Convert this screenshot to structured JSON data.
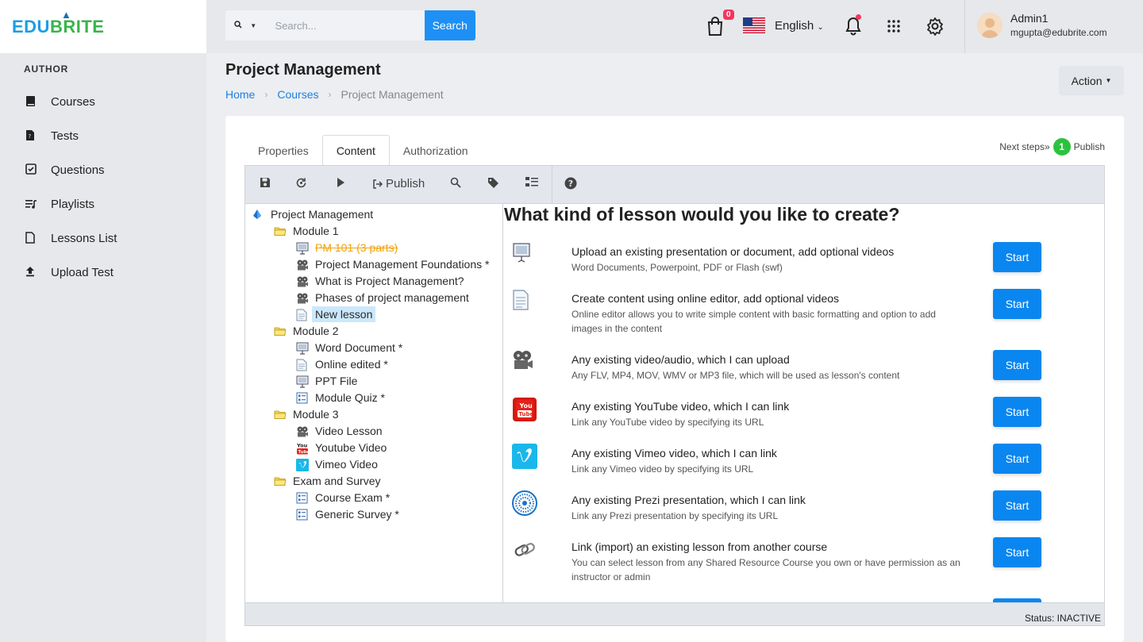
{
  "logo": {
    "part1": "EDU",
    "part2": "BRITE"
  },
  "sidebar": {
    "section": "AUTHOR",
    "items": [
      {
        "label": "Courses",
        "icon": "book-icon"
      },
      {
        "label": "Tests",
        "icon": "test-file-icon"
      },
      {
        "label": "Questions",
        "icon": "checkbox-icon"
      },
      {
        "label": "Playlists",
        "icon": "playlist-icon"
      },
      {
        "label": "Lessons List",
        "icon": "file-icon"
      },
      {
        "label": "Upload Test",
        "icon": "upload-icon"
      }
    ]
  },
  "topbar": {
    "search_placeholder": "Search...",
    "search_button": "Search",
    "cart_count": "0",
    "language": "English",
    "user_name": "Admin1",
    "user_email": "mgupta@edubrite.com"
  },
  "page": {
    "title": "Project Management",
    "breadcrumb": [
      "Home",
      "Courses",
      "Project Management"
    ],
    "action_label": "Action"
  },
  "tabs": [
    "Properties",
    "Content",
    "Authorization"
  ],
  "next_steps": {
    "label": "Next steps»",
    "number": "1",
    "step": "Publish"
  },
  "toolbar": {
    "publish_label": "Publish"
  },
  "tree": [
    {
      "label": "Project Management",
      "level": 0,
      "icon": "course-icon"
    },
    {
      "label": "Module 1",
      "level": 1,
      "icon": "folder-icon"
    },
    {
      "label": "PM 101 (3 parts)",
      "level": 2,
      "icon": "presentation-icon",
      "strike": true
    },
    {
      "label": "Project Management Foundations *",
      "level": 2,
      "icon": "video-reel-icon"
    },
    {
      "label": "What is Project Management?",
      "level": 2,
      "icon": "video-reel-icon"
    },
    {
      "label": "Phases of project management",
      "level": 2,
      "icon": "video-reel-icon"
    },
    {
      "label": "New lesson",
      "level": 2,
      "icon": "document-icon",
      "selected": true
    },
    {
      "label": "Module 2",
      "level": 1,
      "icon": "folder-icon"
    },
    {
      "label": "Word Document *",
      "level": 2,
      "icon": "presentation-icon"
    },
    {
      "label": "Online edited *",
      "level": 2,
      "icon": "document-icon"
    },
    {
      "label": "PPT File",
      "level": 2,
      "icon": "presentation-icon"
    },
    {
      "label": "Module Quiz *",
      "level": 2,
      "icon": "quiz-icon"
    },
    {
      "label": "Module 3",
      "level": 1,
      "icon": "folder-icon"
    },
    {
      "label": "Video Lesson",
      "level": 2,
      "icon": "video-reel-icon"
    },
    {
      "label": "Youtube Video",
      "level": 2,
      "icon": "youtube-icon"
    },
    {
      "label": "Vimeo Video",
      "level": 2,
      "icon": "vimeo-icon"
    },
    {
      "label": "Exam and Survey",
      "level": 1,
      "icon": "folder-icon"
    },
    {
      "label": "Course Exam *",
      "level": 2,
      "icon": "quiz-icon"
    },
    {
      "label": "Generic Survey *",
      "level": 2,
      "icon": "quiz-icon"
    }
  ],
  "content": {
    "heading": "What kind of lesson would you like to create?",
    "start_label": "Start",
    "options": [
      {
        "title": "Upload an existing presentation or document, add optional videos",
        "desc": "Word Documents, Powerpoint, PDF or Flash (swf)",
        "icon": "presentation-icon"
      },
      {
        "title": "Create content using online editor, add optional videos",
        "desc": "Online editor allows you to write simple content with basic formatting and option to add images in the content",
        "icon": "document-icon"
      },
      {
        "title": "Any existing video/audio, which I can upload",
        "desc": "Any FLV, MP4, MOV, WMV or MP3 file, which will be used as lesson's content",
        "icon": "video-reel-icon"
      },
      {
        "title": "Any existing YouTube video, which I can link",
        "desc": "Link any YouTube video by specifying its URL",
        "icon": "youtube-icon"
      },
      {
        "title": "Any existing Vimeo video, which I can link",
        "desc": "Link any Vimeo video by specifying its URL",
        "icon": "vimeo-icon"
      },
      {
        "title": "Any existing Prezi presentation, which I can link",
        "desc": "Link any Prezi presentation by specifying its URL",
        "icon": "prezi-icon"
      },
      {
        "title": "Link (import) an existing lesson from another course",
        "desc": "You can select lesson from any Shared Resource Course you own or have permission as an instructor or admin",
        "icon": "link-icon"
      }
    ]
  },
  "status": "Status: INACTIVE",
  "colors": {
    "primary": "#0a86f0",
    "accent_green": "#2bc23e",
    "badge": "#f5365c"
  }
}
